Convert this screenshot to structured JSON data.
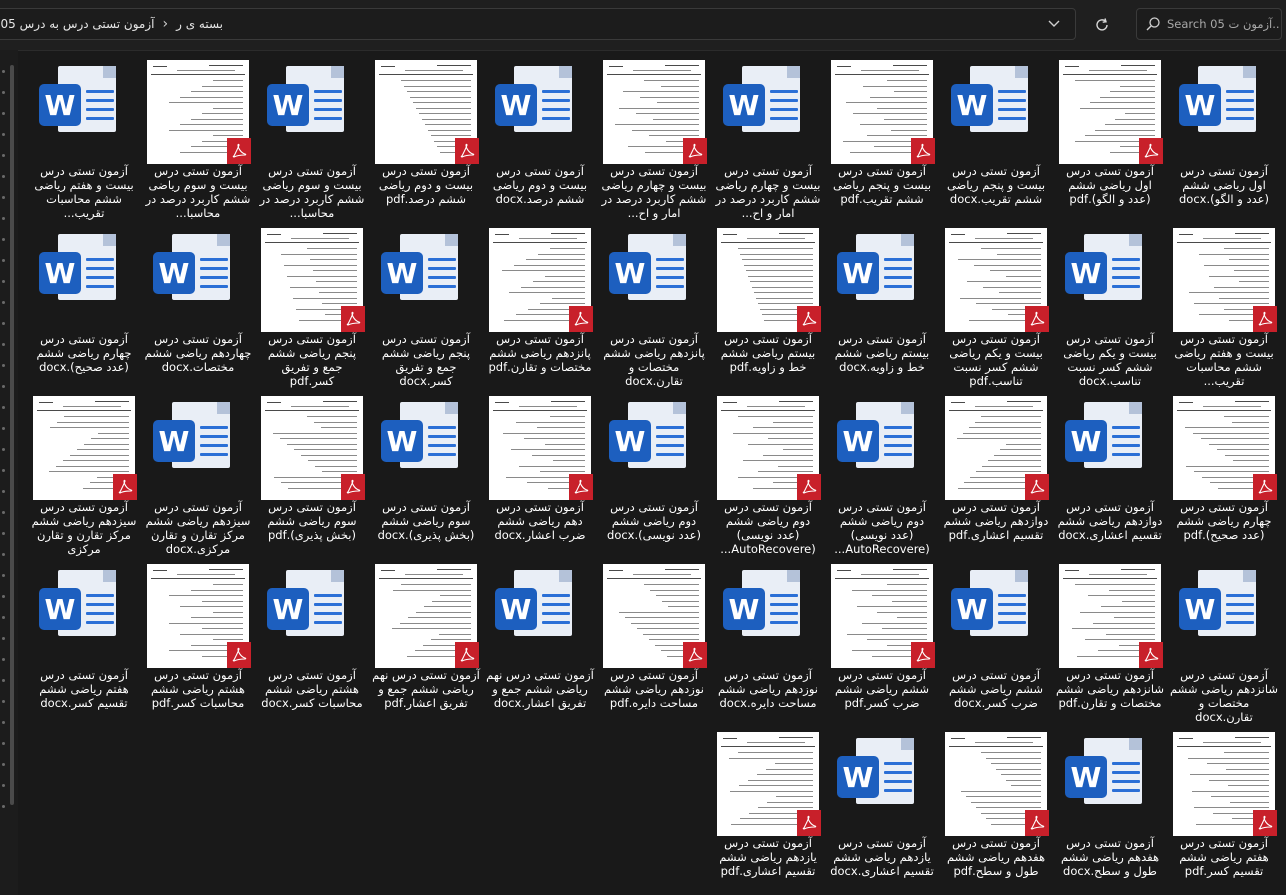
{
  "window": {
    "breadcrumbs": [
      "بسته ی ر",
      "آزمون تستی درس به درس 05"
    ],
    "search_placeholder": "Search آزمون ت 05..."
  },
  "icons": {
    "refresh": "refresh-icon",
    "search": "search-icon",
    "dropdown": "chevron-down-icon",
    "separator": "chevron-right-icon"
  },
  "colors": {
    "background": "#191919",
    "word_blue": "#1d5fbf",
    "pdf_red": "#c8202a"
  },
  "files": [
    {
      "type": "docx",
      "label": "آزمون تستی درس اول ریاضی ششم (عدد و الگو).docx"
    },
    {
      "type": "pdf",
      "label": "آزمون تستی درس اول ریاضی ششم (عدد و الگو).pdf"
    },
    {
      "type": "docx",
      "label": "آزمون تستی درس بیست و پنجم ریاضی ششم تقریب.docx"
    },
    {
      "type": "pdf",
      "label": "آزمون تستی درس بیست و پنجم ریاضی ششم تقریب.pdf"
    },
    {
      "type": "docx",
      "label": "آزمون تستی درس بیست و چهارم ریاضی ششم کاربرد درصد در امار و اح..."
    },
    {
      "type": "pdf",
      "label": "آزمون تستی درس بیست و چهارم ریاضی ششم کاربرد درصد در امار و اح..."
    },
    {
      "type": "docx",
      "label": "آزمون تستی درس بیست و دوم ریاضی ششم درصد.docx"
    },
    {
      "type": "pdf",
      "label": "آزمون تستی درس بیست و دوم ریاضی ششم درصد.pdf"
    },
    {
      "type": "docx",
      "label": "آزمون تستی درس بیست و سوم ریاضی ششم کاربرد درصد در محاسبا..."
    },
    {
      "type": "pdf",
      "label": "آزمون تستی درس بیست و سوم ریاضی ششم کاربرد درصد در محاسبا..."
    },
    {
      "type": "docx",
      "label": "آزمون تستی درس بیست و هفتم ریاضی ششم محاسبات تقریب..."
    },
    {
      "type": "pdf",
      "label": "آزمون تستی درس بیست و هفتم ریاضی ششم محاسبات تقریب..."
    },
    {
      "type": "docx",
      "label": "آزمون تستی درس بیست و یکم ریاضی ششم کسر نسبت تناسب.docx"
    },
    {
      "type": "pdf",
      "label": "آزمون تستی درس بیست و یکم ریاضی ششم کسر نسبت تناسب.pdf"
    },
    {
      "type": "docx",
      "label": "آزمون تستی درس بیستم ریاضی ششم خط و زاویه.docx"
    },
    {
      "type": "pdf",
      "label": "آزمون تستی درس بیستم ریاضی ششم خط و زاویه.pdf"
    },
    {
      "type": "docx",
      "label": "آزمون تستی درس پانزدهم ریاضی ششم مختصات و تقارن.docx"
    },
    {
      "type": "pdf",
      "label": "آزمون تستی درس پانزدهم ریاضی ششم مختصات و تقارن.pdf"
    },
    {
      "type": "docx",
      "label": "آزمون تستی درس پنجم ریاضی ششم جمع و تفریق کسر.docx"
    },
    {
      "type": "pdf",
      "label": "آزمون تستی درس پنجم ریاضی ششم جمع و تفریق کسر.pdf"
    },
    {
      "type": "docx",
      "label": "آزمون تستی درس چهاردهم ریاضی ششم مختصات.docx"
    },
    {
      "type": "docx",
      "label": "آزمون تستی درس چهارم ریاضی ششم (عدد صحیح).docx"
    },
    {
      "type": "pdf",
      "label": "آزمون تستی درس چهارم ریاضی ششم (عدد صحیح).pdf"
    },
    {
      "type": "docx",
      "label": "آزمون تستی درس دوازدهم ریاضی ششم تقسیم اعشاری.docx"
    },
    {
      "type": "pdf",
      "label": "آزمون تستی درس دوازدهم ریاضی ششم تقسیم اعشاری.pdf"
    },
    {
      "type": "docx",
      "label": "آزمون تستی درس دوم ریاضی ششم (عدد نویسی) (AutoRecovere..."
    },
    {
      "type": "pdf",
      "label": "آزمون تستی درس دوم ریاضی ششم (عدد نویسی) (AutoRecovere..."
    },
    {
      "type": "docx",
      "label": "آزمون تستی درس دوم ریاضی ششم (عدد نویسی).docx"
    },
    {
      "type": "pdf",
      "label": "آزمون تستی درس دهم ریاضی ششم ضرب اعشار.docx"
    },
    {
      "type": "docx",
      "label": "آزمون تستی درس سوم ریاضی ششم (بخش پذیری).docx"
    },
    {
      "type": "pdf",
      "label": "آزمون تستی درس سوم ریاضی ششم (بخش پذیری).pdf"
    },
    {
      "type": "docx",
      "label": "آزمون تستی درس سیزدهم ریاضی ششم مرکز تقارن و تقارن مرکزی.docx"
    },
    {
      "type": "pdf",
      "label": "آزمون تستی درس سیزدهم ریاضی ششم مرکز تقارن و تقارن مرکزی"
    },
    {
      "type": "docx",
      "label": "آزمون تستی درس شانزدهم ریاضی ششم مختصات و تقارن.docx"
    },
    {
      "type": "pdf",
      "label": "آزمون تستی درس شانزدهم ریاضی ششم مختصات و تقارن.pdf"
    },
    {
      "type": "docx",
      "label": "آزمون تستی درس ششم ریاضی ششم ضرب کسر.docx"
    },
    {
      "type": "pdf",
      "label": "آزمون تستی درس ششم ریاضی ششم ضرب کسر.pdf"
    },
    {
      "type": "docx",
      "label": "آزمون تستی درس نوزدهم ریاضی ششم مساحت دایره.docx"
    },
    {
      "type": "pdf",
      "label": "آزمون تستی درس نوزدهم ریاضی ششم مساحت دایره.pdf"
    },
    {
      "type": "docx",
      "label": "آزمون تستی درس نهم ریاضی ششم جمع و تفریق اعشار.docx"
    },
    {
      "type": "pdf",
      "label": "آزمون تستی درس نهم ریاضی ششم جمع و تفریق اعشار.pdf"
    },
    {
      "type": "docx",
      "label": "آزمون تستی درس هشتم ریاضی ششم محاسبات کسر.docx"
    },
    {
      "type": "pdf",
      "label": "آزمون تستی درس هشتم ریاضی ششم محاسبات کسر.pdf"
    },
    {
      "type": "docx",
      "label": "آزمون تستی درس هفتم ریاضی ششم تقسیم کسر.docx"
    },
    {
      "type": "pdf",
      "label": "آزمون تستی درس هفتم ریاضی ششم تقسیم کسر.pdf"
    },
    {
      "type": "docx",
      "label": "آزمون تستی درس هفدهم ریاضی ششم طول و سطح.docx"
    },
    {
      "type": "pdf",
      "label": "آزمون تستی درس هفدهم ریاضی ششم طول و سطح.pdf"
    },
    {
      "type": "docx",
      "label": "آزمون تستی درس یازدهم ریاضی ششم تقسیم اعشاری.docx"
    },
    {
      "type": "pdf",
      "label": "آزمون تستی درس یازدهم ریاضی ششم تقسیم اعشاری.pdf"
    }
  ]
}
